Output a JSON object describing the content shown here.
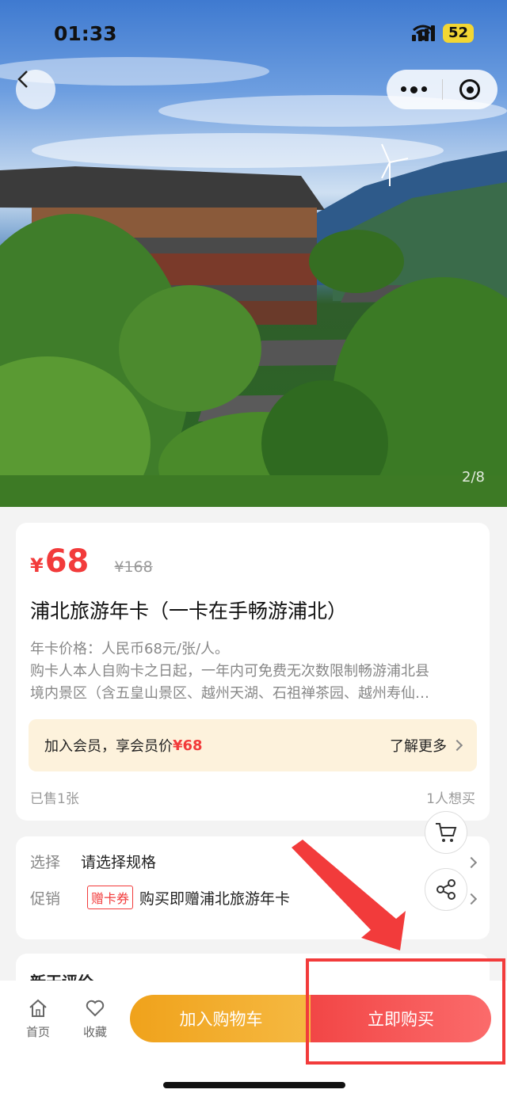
{
  "status_bar": {
    "time": "01:33",
    "battery": "52"
  },
  "gallery": {
    "counter": "2/8"
  },
  "product": {
    "price_symbol": "¥",
    "price": "68",
    "original_price": "¥168",
    "title": "浦北旅游年卡（一卡在手畅游浦北）",
    "desc_line1": "年卡价格：人民币68元/张/人。",
    "desc_line2": "购卡人本人自购卡之日起，一年内可免费无次数限制畅游浦北县",
    "desc_line3": "境内景区（含五皇山景区、越州天湖、石祖禅茶园、越州寿仙…",
    "member_text": "加入会员，享会员价",
    "member_price": "¥68",
    "member_more": "了解更多",
    "sold": "已售1张",
    "want": "1人想买"
  },
  "spec": {
    "select_label": "选择",
    "select_value": "请选择规格",
    "promo_label": "促销",
    "promo_tag": "赠卡券",
    "promo_value": "购买即赠浦北旅游年卡"
  },
  "review": {
    "title": "新天评价"
  },
  "bottom_nav": {
    "home": "首页",
    "favorite": "收藏",
    "add_cart": "加入购物车",
    "buy_now": "立即购买"
  },
  "colors": {
    "accent_red": "#f23b3b",
    "accent_orange": "#f0a21b",
    "member_bg": "#fdf2dc"
  }
}
